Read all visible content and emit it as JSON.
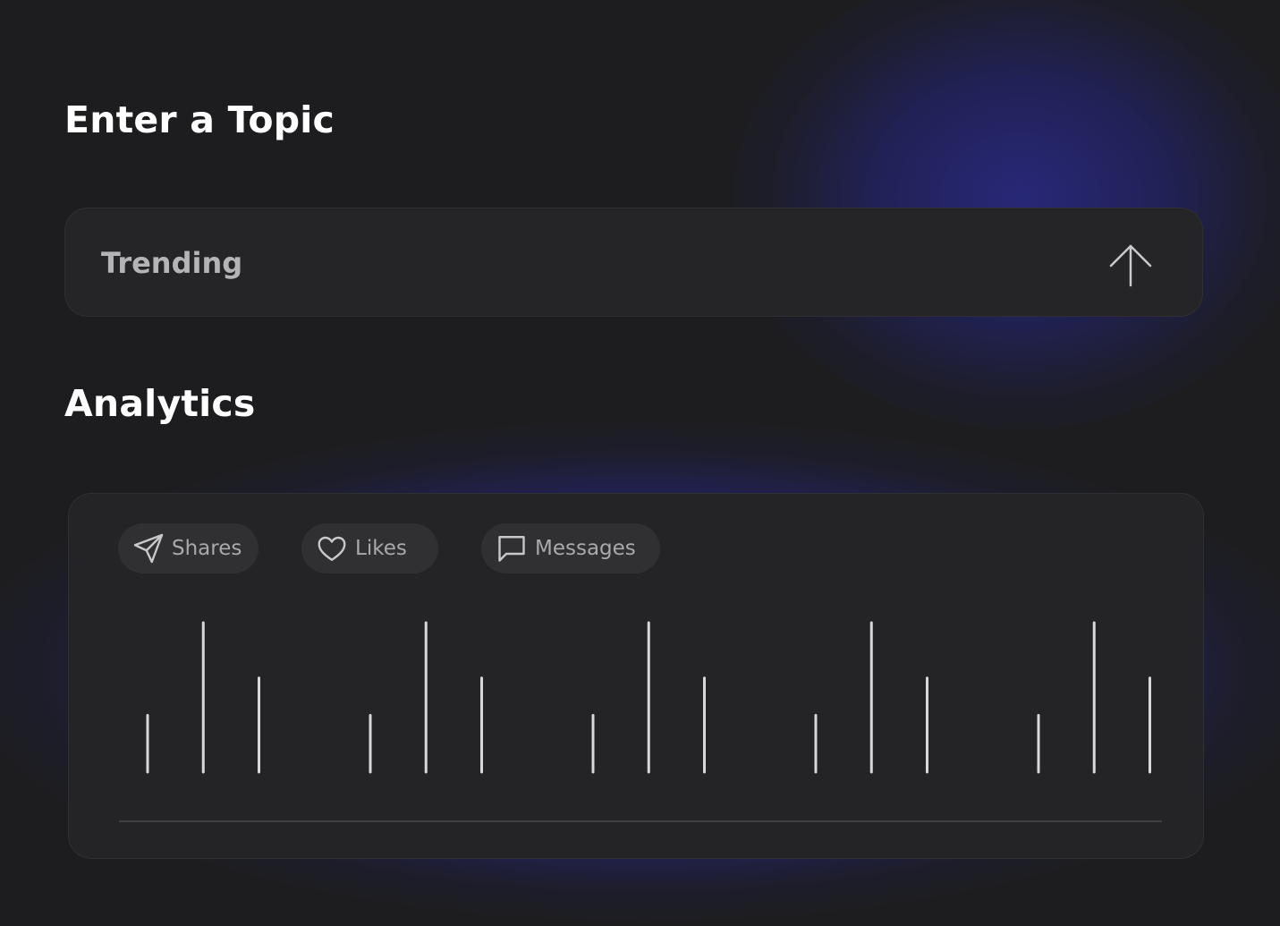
{
  "topic_section": {
    "heading": "Enter a Topic",
    "input_value": "Trending"
  },
  "analytics_section": {
    "heading": "Analytics",
    "filters": [
      {
        "label": "Shares",
        "icon": "send-icon"
      },
      {
        "label": "Likes",
        "icon": "heart-icon"
      },
      {
        "label": "Messages",
        "icon": "message-icon"
      }
    ]
  },
  "colors": {
    "background": "#1d1d20",
    "glow": "#28287d",
    "card": "#242426",
    "pill": "#303033",
    "bar": "#d8d8dc"
  },
  "chart_data": {
    "type": "bar",
    "title": "",
    "xlabel": "",
    "ylabel": "",
    "grid": false,
    "legend": "none",
    "ylim": [
      0,
      1
    ],
    "values": [
      0.38,
      1.0,
      0.63,
      0.38,
      1.0,
      0.63,
      0.38,
      1.0,
      0.63,
      0.38,
      1.0,
      0.63,
      0.38,
      1.0,
      0.63
    ]
  }
}
